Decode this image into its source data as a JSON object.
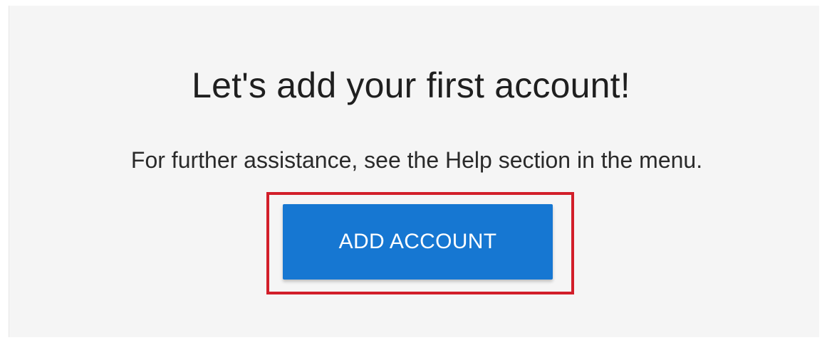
{
  "onboarding": {
    "headline": "Let's add your first account!",
    "help_text": "For further assistance, see the Help section in the menu.",
    "add_account_label": "ADD ACCOUNT"
  },
  "colors": {
    "button_background": "#1677d2",
    "highlight_border": "#d21f2a",
    "panel_background": "#f5f5f5"
  }
}
